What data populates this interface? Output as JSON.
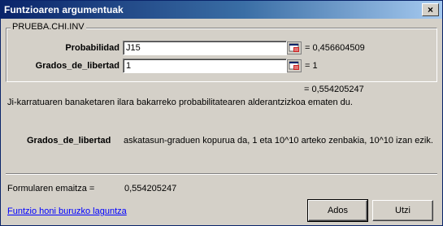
{
  "window": {
    "title": "Funtzioaren argumentuak",
    "close_glyph": "×"
  },
  "function_group": {
    "name": "PRUEBA.CHI.INV",
    "args": [
      {
        "label": "Probabilidad",
        "value": "J15",
        "result": "= 0,456604509",
        "icon": "collapse-dialog-icon"
      },
      {
        "label": "Grados_de_libertad",
        "value": "1",
        "result": "= 1",
        "icon": "collapse-dialog-icon"
      }
    ]
  },
  "function_result": "= 0,554205247",
  "function_description": "Ji-karratuaren banaketaren ilara bakarreko probabilitatearen alderantzizkoa ematen du.",
  "arg_help": {
    "name": "Grados_de_libertad",
    "text": "askatasun-graduen kopurua da, 1 eta 10^10 arteko zenbakia, 10^10 izan ezik."
  },
  "formula_result": {
    "label": "Formularen emaitza =",
    "value": "0,554205247"
  },
  "help_link": "Funtzio honi buruzko laguntza",
  "buttons": {
    "ok": "Ados",
    "cancel": "Utzi"
  },
  "colors": {
    "titlebar_start": "#0a246a",
    "titlebar_end": "#a6caf0",
    "face": "#d4d0c8",
    "link": "#0000ff"
  }
}
